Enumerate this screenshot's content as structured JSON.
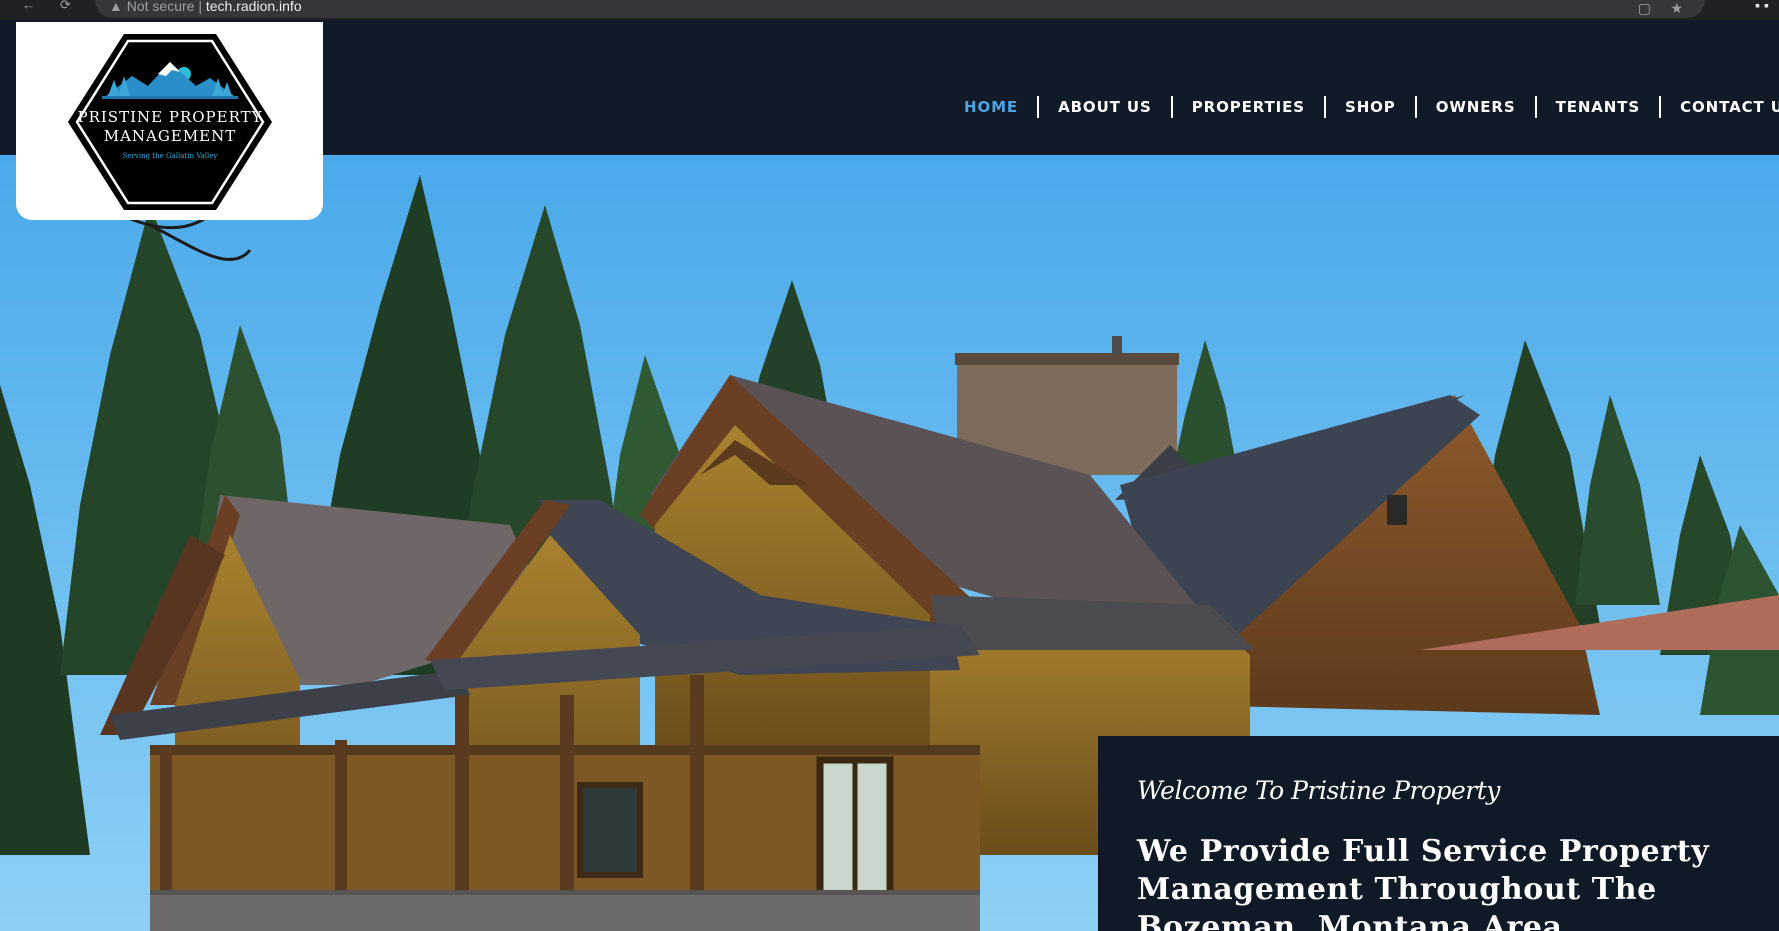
{
  "browser": {
    "security_label": "Not secure",
    "separator": "|",
    "host": "tech.radion.info"
  },
  "logo": {
    "line1": "PRISTINE PROPERTY",
    "line2": "MANAGEMENT",
    "tagline": "Serving the Gallatin Valley"
  },
  "nav": {
    "items": [
      {
        "label": "HOME",
        "active": true
      },
      {
        "label": "ABOUT US"
      },
      {
        "label": "PROPERTIES"
      },
      {
        "label": "SHOP"
      },
      {
        "label": "OWNERS"
      },
      {
        "label": "TENANTS"
      },
      {
        "label": "CONTACT US"
      }
    ]
  },
  "welcome": {
    "kicker": "Welcome To Pristine Property",
    "headline": "We Provide Full Service Property Management Throughout The Bozeman, Montana Area"
  },
  "colors": {
    "header_bg": "#111b27",
    "nav_active": "#4da3e3",
    "nav_text": "#ffffff",
    "panel_bg": "#101a26",
    "sky": "#63b8ef"
  },
  "icons": [
    "back-icon",
    "reload-icon",
    "not-secure-icon",
    "bookmark-icon",
    "star-icon",
    "extensions-icon",
    "menu-icon"
  ]
}
